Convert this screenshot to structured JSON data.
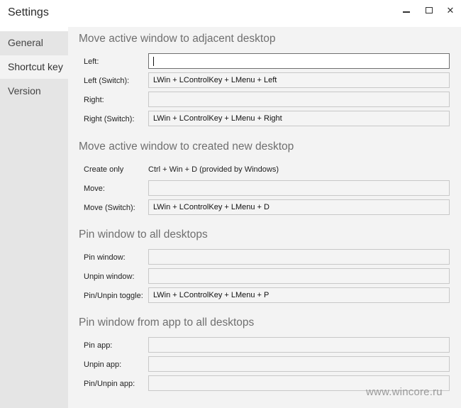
{
  "window": {
    "title": "Settings",
    "close_glyph": "✕",
    "icons": [
      "minimize-icon",
      "maximize-icon",
      "close-icon"
    ]
  },
  "sidebar": {
    "items": [
      {
        "label": "General"
      },
      {
        "label": "Shortcut key"
      },
      {
        "label": "Version"
      }
    ],
    "selected": "Shortcut key"
  },
  "sections": {
    "adjacent": {
      "title": "Move active window to adjacent desktop",
      "left": {
        "label": "Left:",
        "value": ""
      },
      "left_switch": {
        "label": "Left (Switch):",
        "value": "LWin + LControlKey + LMenu + Left"
      },
      "right": {
        "label": "Right:",
        "value": ""
      },
      "right_switch": {
        "label": "Right (Switch):",
        "value": "LWin + LControlKey + LMenu + Right"
      }
    },
    "new_desktop": {
      "title": "Move active window to created new desktop",
      "create_only": {
        "label": "Create only",
        "value": "Ctrl + Win + D (provided by Windows)"
      },
      "move": {
        "label": "Move:",
        "value": ""
      },
      "move_switch": {
        "label": "Move (Switch):",
        "value": "LWin + LControlKey + LMenu + D"
      }
    },
    "pin_window": {
      "title": "Pin window to all desktops",
      "pin": {
        "label": "Pin window:",
        "value": ""
      },
      "unpin": {
        "label": "Unpin window:",
        "value": ""
      },
      "toggle": {
        "label": "Pin/Unpin toggle:",
        "value": "LWin + LControlKey + LMenu + P"
      }
    },
    "pin_app": {
      "title": "Pin window from app to all desktops",
      "pin": {
        "label": "Pin app:",
        "value": ""
      },
      "unpin": {
        "label": "Unpin app:",
        "value": ""
      },
      "toggle": {
        "label": "Pin/Unpin app:",
        "value": ""
      }
    }
  },
  "watermark": "www.wincore.ru",
  "colors": {
    "sidebar_bg": "#e5e5e5",
    "content_bg": "#f3f3f3",
    "section_title": "#6f6f6f",
    "focused_border": "#6f6f6f"
  }
}
